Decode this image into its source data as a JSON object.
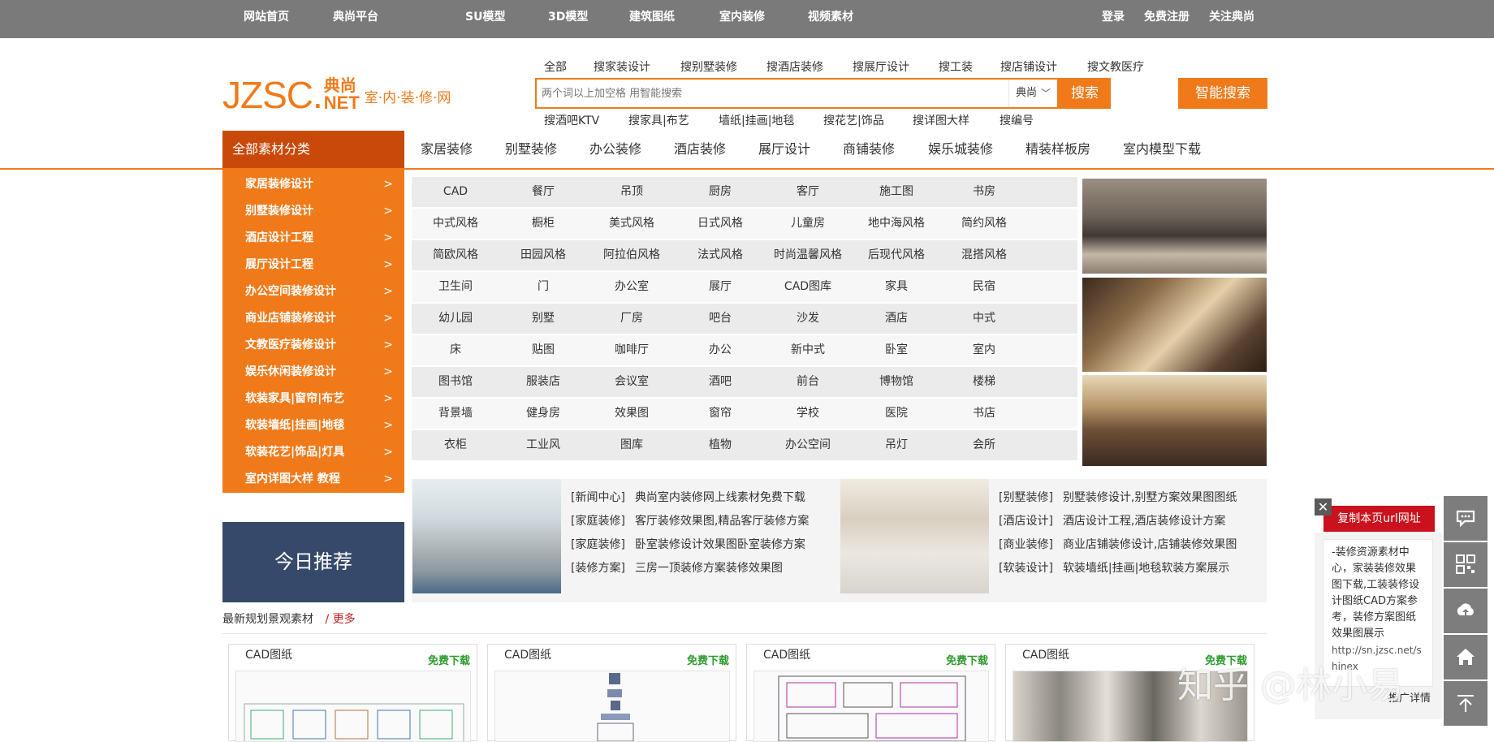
{
  "topbar": {
    "left": [
      "网站首页",
      "典尚平台",
      "SU模型",
      "3D模型",
      "建筑图纸",
      "室内装修",
      "视频素材"
    ],
    "right": [
      "登录",
      "免费注册",
      "关注典尚"
    ]
  },
  "logo": {
    "en": "JZSC.",
    "cn_top": "典尚",
    "cn_bottom": "NET",
    "slogan": "室·内·装·修·网"
  },
  "search": {
    "tabs": [
      "全部",
      "搜家装设计",
      "搜别墅装修",
      "搜酒店装修",
      "搜展厅设计",
      "搜工装",
      "搜店铺设计",
      "搜文教医疗"
    ],
    "placeholder": "两个词以上加空格 用智能搜索",
    "select_value": "典尚",
    "search_button": "搜索",
    "smart_button": "智能搜索",
    "hotwords": [
      "搜酒吧KTV",
      "搜家具|布艺",
      "墙纸|挂画|地毯",
      "搜花艺|饰品",
      "搜详图大样",
      "搜编号"
    ]
  },
  "nav": {
    "all_category": "全部素材分类",
    "items": [
      "家居装修",
      "别墅装修",
      "办公装修",
      "酒店装修",
      "展厅设计",
      "商铺装修",
      "娱乐城装修",
      "精装样板房",
      "室内模型下载"
    ]
  },
  "sidebar": {
    "items": [
      "家居装修设计",
      "别墅装修设计",
      "酒店设计工程",
      "展厅设计工程",
      "办公空间装修设计",
      "商业店铺装修设计",
      "文教医疗装修设计",
      "娱乐休闲装修设计",
      "软装家具|窗帘|布艺",
      "软装墙纸|挂画|地毯",
      "软装花艺|饰品|灯具",
      "室内详图大样 教程"
    ],
    "arrow": ">"
  },
  "categories": [
    [
      "CAD",
      "餐厅",
      "吊顶",
      "厨房",
      "客厅",
      "施工图",
      "书房"
    ],
    [
      "中式风格",
      "橱柜",
      "美式风格",
      "日式风格",
      "儿童房",
      "地中海风格",
      "简约风格"
    ],
    [
      "简欧风格",
      "田园风格",
      "阿拉伯风格",
      "法式风格",
      "时尚温馨风格",
      "后现代风格",
      "混搭风格"
    ],
    [
      "卫生间",
      "门",
      "办公室",
      "展厅",
      "CAD图库",
      "家具",
      "民宿"
    ],
    [
      "幼儿园",
      "别墅",
      "厂房",
      "吧台",
      "沙发",
      "酒店",
      "中式"
    ],
    [
      "床",
      "贴图",
      "咖啡厅",
      "办公",
      "新中式",
      "卧室",
      "室内"
    ],
    [
      "图书馆",
      "服装店",
      "会议室",
      "酒吧",
      "前台",
      "博物馆",
      "楼梯"
    ],
    [
      "背景墙",
      "健身房",
      "效果图",
      "窗帘",
      "学校",
      "医院",
      "书店"
    ],
    [
      "衣柜",
      "工业风",
      "图库",
      "植物",
      "办公空间",
      "吊灯",
      "会所"
    ]
  ],
  "news_left": [
    {
      "tag": "[新闻中心]",
      "text": "典尚室内装修网上线素材免费下载"
    },
    {
      "tag": "[家庭装修]",
      "text": "客厅装修效果图,精品客厅装修方案"
    },
    {
      "tag": "[家庭装修]",
      "text": "卧室装修设计效果图卧室装修方案"
    },
    {
      "tag": "[装修方案]",
      "text": "三房一顶装修方案装修效果图"
    }
  ],
  "news_right": [
    {
      "tag": "[别墅装修]",
      "text": "别墅装修设计,别墅方案效果图图纸"
    },
    {
      "tag": "[酒店设计]",
      "text": "酒店设计工程,酒店装修设计方案"
    },
    {
      "tag": "[商业装修]",
      "text": "商业店铺装修设计,店铺装修效果图"
    },
    {
      "tag": "[软装设计]",
      "text": "软装墙纸|挂画|地毯软装方案展示"
    }
  ],
  "today": "今日推荐",
  "latest": {
    "title": "最新规划景观素材",
    "more": "/ 更多"
  },
  "cards": [
    {
      "title": "CAD图纸",
      "free": "免费下载"
    },
    {
      "title": "CAD图纸",
      "free": "免费下载"
    },
    {
      "title": "CAD图纸",
      "free": "免费下载"
    },
    {
      "title": "CAD图纸",
      "free": "免费下载"
    }
  ],
  "float": {
    "close": "✕",
    "copy_button": "复制本页url网址",
    "text": "-装修资源素材中心，家装装修效果图下载,工装装修设计图纸CAD方案参考，装修方案图纸效果图展示",
    "url_partial": "http://sn.jzsc.net/shinex",
    "detail": "推广详情"
  },
  "tools": [
    "chat-icon",
    "qrcode-icon",
    "upload-icon",
    "home-icon",
    "back-to-top-icon"
  ],
  "watermark": "知乎 @林小易",
  "colors": {
    "accent": "#f07a1a",
    "nav_dark": "#c9490a",
    "topbar": "#7a7a7a",
    "today": "#36496a",
    "copy_red": "#c9121d",
    "free_green": "#2e9a2e"
  }
}
